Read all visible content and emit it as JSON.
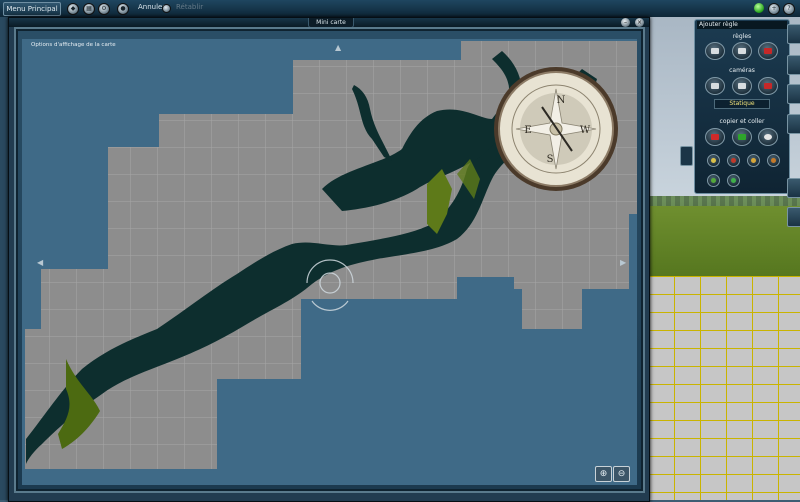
{
  "toolbar": {
    "menu_label": "Menu Principal",
    "undo_label": "Annuler",
    "redo_label": "Rétablir"
  },
  "minimap": {
    "title": "Mini carte",
    "options_label": "Options d'affichage de la carte",
    "compass": {
      "north": "N",
      "south": "S",
      "east": "E",
      "west": "W"
    }
  },
  "panel": {
    "title": "Ajouter règle",
    "rules_label": "règles",
    "cameras_label": "caméras",
    "camera_mode": "Statique",
    "copy_paste_label": "copier et coller"
  },
  "colors": {
    "sea": "#3f6a87",
    "land_tiles": "#8d8d8d",
    "water": "#0c2f2f",
    "vegetation": "#4c6a11",
    "accent_green": "#22a019"
  }
}
